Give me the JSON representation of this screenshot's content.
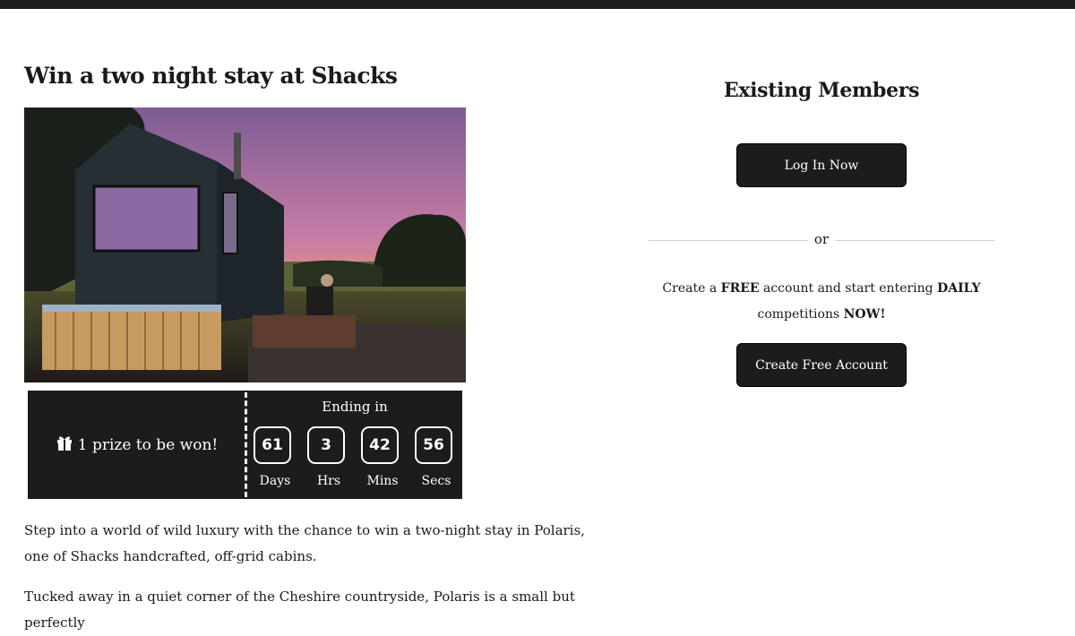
{
  "competition": {
    "title": "Win a two night stay at Shacks",
    "image_alt": "Dark timber off-grid cabin with hot tub at sunset",
    "prize_text": "1 prize to be won!",
    "ending_label": "Ending in",
    "countdown": [
      {
        "value": "61",
        "label": "Days"
      },
      {
        "value": "3",
        "label": "Hrs"
      },
      {
        "value": "42",
        "label": "Mins"
      },
      {
        "value": "56",
        "label": "Secs"
      }
    ],
    "description": [
      "Step into a world of wild luxury with the chance to win a two-night stay in Polaris, one of Shacks handcrafted, off-grid cabins.",
      "Tucked away in a quiet corner of the Cheshire countryside, Polaris is a small but perfectly"
    ]
  },
  "members": {
    "title": "Existing Members",
    "login_label": "Log In Now",
    "or_text": "or",
    "cta_parts": [
      "Create a ",
      "FREE",
      " account and start entering ",
      "DAILY",
      " competitions ",
      "NOW!"
    ],
    "create_label": "Create Free Account"
  },
  "colors": {
    "dark_panel": "#1c1c1c",
    "top_bar": "#1e1e1e",
    "background": "#ffffff"
  },
  "icons": {
    "gift": "gift-icon"
  }
}
